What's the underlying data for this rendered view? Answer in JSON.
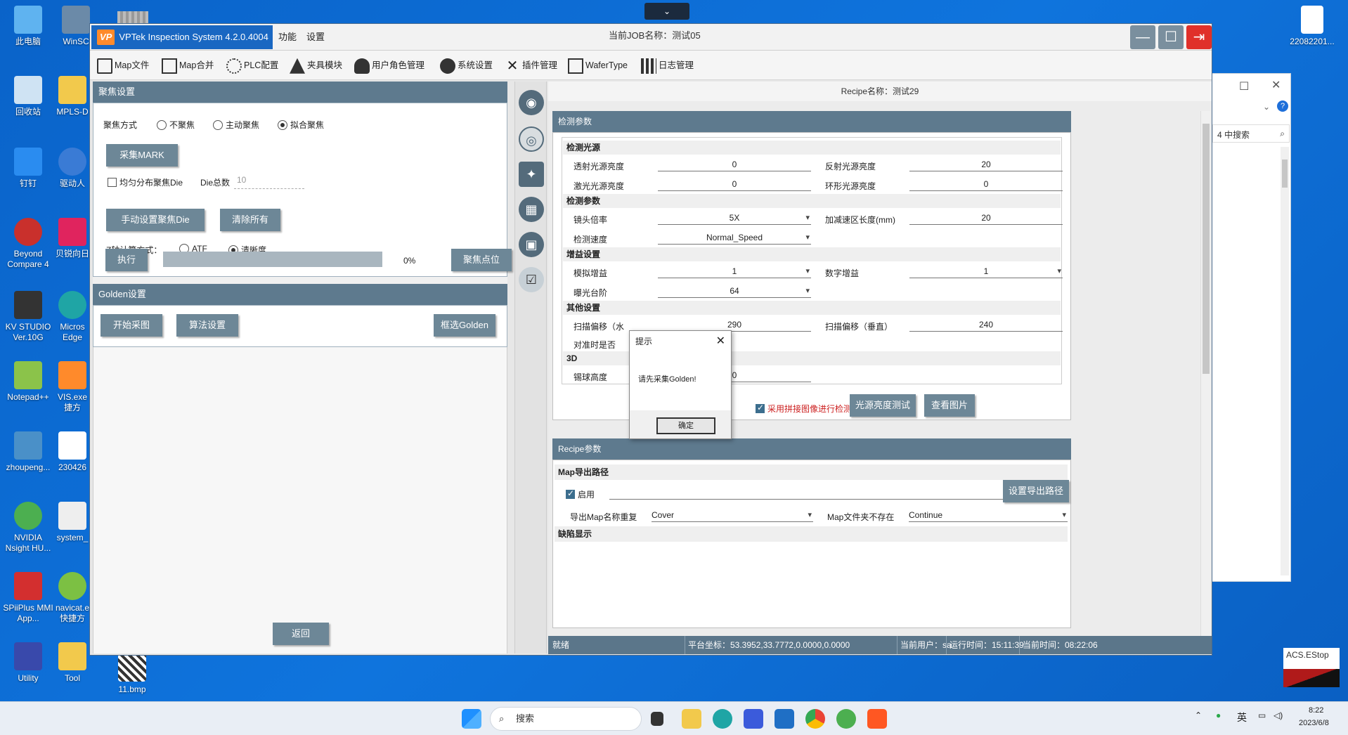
{
  "desktop": {
    "icons": [
      {
        "label": "此电脑"
      },
      {
        "label": "WinSC"
      },
      {
        "label": "回收站"
      },
      {
        "label": "MPLS-D"
      },
      {
        "label": "钉钉"
      },
      {
        "label": "驱动人"
      },
      {
        "label": "Beyond Compare 4"
      },
      {
        "label": "贝锐向日"
      },
      {
        "label": "KV STUDIO Ver.10G"
      },
      {
        "label": "Micros Edge"
      },
      {
        "label": "Notepad++"
      },
      {
        "label": "VIS.exe 捷方"
      },
      {
        "label": "zhoupeng..."
      },
      {
        "label": "230426"
      },
      {
        "label": "NVIDIA Nsight HU..."
      },
      {
        "label": "system_"
      },
      {
        "label": "SPiiPlus MMI App..."
      },
      {
        "label": "navicat.e 快捷方"
      },
      {
        "label": "Utility"
      },
      {
        "label": "Tool"
      },
      {
        "label": "11.bmp"
      },
      {
        "label": "22082201..."
      }
    ]
  },
  "bg_window": {
    "search_placeholder": "4 中搜索"
  },
  "app": {
    "logo": "VP",
    "title": "VPTek Inspection System 4.2.0.4004",
    "menu": [
      "功能",
      "设置"
    ],
    "job_name": "当前JOB名称：测试05",
    "toolbar": [
      "Map文件",
      "Map合并",
      "PLC配置",
      "夹具模块",
      "用户角色管理",
      "系统设置",
      "插件管理",
      "WaferType",
      "日志管理"
    ]
  },
  "focus": {
    "header": "聚焦设置",
    "mode_label": "聚焦方式",
    "modes": [
      "不聚焦",
      "主动聚焦",
      "拟合聚焦"
    ],
    "mode_selected": "拟合聚焦",
    "collect_mark": "采集MARK",
    "uniform_die": "均匀分布聚焦Die",
    "die_total_label": "Die总数",
    "die_total_value": "10",
    "manual_die": "手动设置聚焦Die",
    "clear_all": "清除所有",
    "z_calc_label": "Z轴计算方式：",
    "z_modes": [
      "ATF",
      "清晰度"
    ],
    "z_selected": "清晰度",
    "execute": "执行",
    "progress": 0,
    "progress_text": "0%",
    "focus_point": "聚焦点位"
  },
  "golden": {
    "header": "Golden设置",
    "start_capture": "开始采图",
    "algo_settings": "算法设置",
    "select_golden": "框选Golden",
    "back": "返回"
  },
  "recipe": {
    "title": "Recipe名称：测试29",
    "detect_header": "检测参数",
    "groups": {
      "light": "检测光源",
      "detect": "检测参数",
      "gain": "增益设置",
      "other": "其他设置",
      "three_d": "3D"
    },
    "fields": {
      "transmit_light": {
        "label": "透射光源亮度",
        "value": "0"
      },
      "reflect_light": {
        "label": "反射光源亮度",
        "value": "20"
      },
      "laser_light": {
        "label": "激光光源亮度",
        "value": "0"
      },
      "ring_light": {
        "label": "环形光源亮度",
        "value": "0"
      },
      "lens_mag": {
        "label": "镜头倍率",
        "value": "5X"
      },
      "accel_len": {
        "label": "加减速区长度(mm)",
        "value": "20"
      },
      "detect_speed": {
        "label": "检测速度",
        "value": "Normal_Speed"
      },
      "analog_gain": {
        "label": "模拟增益",
        "value": "1"
      },
      "digital_gain": {
        "label": "数字增益",
        "value": "1"
      },
      "exposure": {
        "label": "曝光台阶",
        "value": "64"
      },
      "scan_offset_h": {
        "label": "扫描偏移（水",
        "value": "290"
      },
      "scan_offset_v": {
        "label": "扫描偏移（垂直）",
        "value": "240"
      },
      "align_when": {
        "label": "对准时是否"
      },
      "bump_height": {
        "label": "锡球高度",
        "value": "0"
      }
    },
    "stitch_detect": "采用拼接图像进行检测",
    "light_test": "光源亮度测试",
    "view_image": "查看图片",
    "recipe_header": "Recipe参数",
    "map_export_group": "Map导出路径",
    "enable": "启用",
    "set_export_path": "设置导出路径",
    "dup_label": "导出Map名称重复",
    "dup_value": "Cover",
    "folder_missing_label": "Map文件夹不存在",
    "folder_missing_value": "Continue",
    "defect_group": "缺陷显示"
  },
  "status": {
    "ready": "就绪",
    "coords": "平台坐标：53.3952,33.7772,0.0000,0.0000",
    "user": "当前用户：sa",
    "runtime": "运行时间：15:11:39",
    "now": "当前时间：08:22:06"
  },
  "dialog": {
    "title": "提示",
    "message": "请先采集Golden!",
    "ok": "确定"
  },
  "acs": {
    "label": "ACS.EStop"
  },
  "taskbar": {
    "search": "搜索",
    "ime": "英",
    "time": "8:22",
    "date": "2023/6/8"
  },
  "colors": {
    "panel_header": "#5e7a8e",
    "button": "#6d8797",
    "title_blue": "#1967c2",
    "close_red": "#e0302a",
    "stitch_red": "#cc1f1f"
  }
}
